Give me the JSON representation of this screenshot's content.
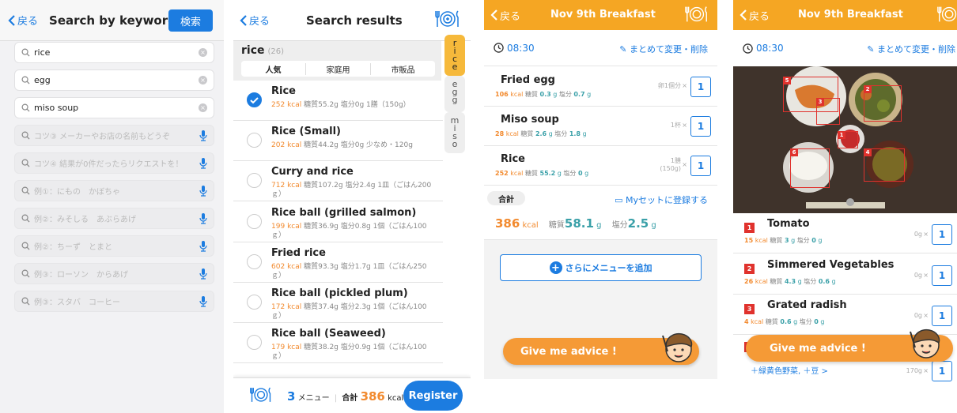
{
  "colors": {
    "accent_blue": "#1c7ce0",
    "orange": "#f5a623",
    "kcal_orange": "#f28a2e",
    "teal": "#3aa0a8",
    "tag_red": "#e0322d"
  },
  "search_screen": {
    "back_label": "戻る",
    "title": "Search by keyword",
    "search_button": "検索",
    "history": [
      {
        "text": "rice"
      },
      {
        "text": "egg"
      },
      {
        "text": "miso soup"
      }
    ],
    "placeholders": [
      {
        "text": "コツ③ メーカーやお店の名前もどうぞ"
      },
      {
        "text": "コツ④ 結果が0件だったらリクエストを！"
      },
      {
        "text": "例①：にもの　かぼちゃ"
      },
      {
        "text": "例②：みそしる　あぶらあげ"
      },
      {
        "text": "例②：ちーず　とまと"
      },
      {
        "text": "例③：ローソン　からあげ"
      },
      {
        "text": "例③：スタバ　コーヒー"
      }
    ]
  },
  "results_screen": {
    "back_label": "戻る",
    "title": "Search results",
    "keyword": "rice",
    "count": "(26)",
    "tabs": [
      "人気",
      "家庭用",
      "市販品"
    ],
    "side_tabs": [
      "r\ni\nc\ne",
      "e\ng\ng",
      "m\ni\ns\no"
    ],
    "items": [
      {
        "name": "Rice",
        "kcal": "252",
        "unit": "kcal",
        "detail": "糖質55.2g  塩分0g  1膳（150g）",
        "checked": true
      },
      {
        "name": "Rice (Small)",
        "kcal": "202",
        "unit": "kcal",
        "detail": "糖質44.2g  塩分0g  少なめ・120g",
        "checked": false
      },
      {
        "name": "Curry and rice",
        "kcal": "712",
        "unit": "kcal",
        "detail": "糖質107.2g  塩分2.4g  1皿（ごはん200ｇ）",
        "checked": false
      },
      {
        "name": "Rice ball (grilled salmon)",
        "kcal": "199",
        "unit": "kcal",
        "detail": "糖質36.9g  塩分0.8g  1個（ごはん100ｇ）",
        "checked": false
      },
      {
        "name": "Fried rice",
        "kcal": "602",
        "unit": "kcal",
        "detail": "糖質93.3g  塩分1.7g  1皿（ごはん250ｇ）",
        "checked": false
      },
      {
        "name": "Rice ball (pickled plum)",
        "kcal": "172",
        "unit": "kcal",
        "detail": "糖質37.4g  塩分2.3g  1個（ごはん100ｇ）",
        "checked": false
      },
      {
        "name": "Rice ball (Seaweed)",
        "kcal": "179",
        "unit": "kcal",
        "detail": "糖質38.2g  塩分0.9g  1個（ごはん100ｇ）",
        "checked": false
      }
    ],
    "footer": {
      "menu_count": "3",
      "menu_label": "メニュー",
      "total_label": "合計",
      "total_kcal": "386",
      "kcal_unit": "kcal",
      "register": "Register"
    }
  },
  "meal_screen": {
    "back_label": "戻る",
    "title": "Nov 9th  Breakfast",
    "time": "08:30",
    "edit_label": "まとめて変更・削除",
    "items": [
      {
        "name": "Fried egg",
        "kcal": "106",
        "kcal_unit": "kcal",
        "carb_label": "糖質",
        "carb": "0.3",
        "carb_unit": "g",
        "salt_label": "塩分",
        "salt": "0.7",
        "salt_unit": "g",
        "portion": "卵1個分",
        "qty": "1"
      },
      {
        "name": "Miso soup",
        "kcal": "28",
        "kcal_unit": "kcal",
        "carb_label": "糖質",
        "carb": "2.6",
        "carb_unit": "g",
        "salt_label": "塩分",
        "salt": "1.8",
        "salt_unit": "g",
        "portion": "1杯",
        "qty": "1"
      },
      {
        "name": "Rice",
        "kcal": "252",
        "kcal_unit": "kcal",
        "carb_label": "糖質",
        "carb": "55.2",
        "carb_unit": "g",
        "salt_label": "塩分",
        "salt": "0",
        "salt_unit": "g",
        "portion": "1膳\n(150g)",
        "qty": "1"
      }
    ],
    "total_label": "合計",
    "myset_label": "Myセットに登録する",
    "total_kcal": "386",
    "kcal_unit": "kcal",
    "carb_label": "糖質",
    "total_carb": "58.1",
    "carb_unit": "g",
    "salt_label": "塩分",
    "total_salt": "2.5",
    "salt_unit": "g",
    "add_menu": "さらにメニューを追加",
    "advice": "Give me advice !"
  },
  "photo_screen": {
    "back_label": "戻る",
    "title": "Nov 9th  Breakfast",
    "time": "08:30",
    "edit_label": "まとめて変更・削除",
    "detections": [
      "5",
      "3",
      "2",
      "1",
      "6",
      "4"
    ],
    "items": [
      {
        "tag": "1",
        "name": "Tomato",
        "kcal": "15",
        "kcal_unit": "kcal",
        "carb_label": "糖質",
        "carb": "3",
        "carb_unit": "g",
        "salt_label": "塩分",
        "salt": "0",
        "salt_unit": "g",
        "grams": "0g",
        "qty": "1"
      },
      {
        "tag": "2",
        "name": "Simmered Vegetables",
        "kcal": "26",
        "kcal_unit": "kcal",
        "carb_label": "糖質",
        "carb": "4.3",
        "carb_unit": "g",
        "salt_label": "塩分",
        "salt": "0.6",
        "salt_unit": "g",
        "grams": "0g",
        "qty": "1"
      },
      {
        "tag": "3",
        "name": "Grated radish",
        "kcal": "4",
        "kcal_unit": "kcal",
        "carb_label": "糖質",
        "carb": "0.6",
        "carb_unit": "g",
        "salt_label": "塩分",
        "salt": "0",
        "salt_unit": "g",
        "grams": "0g",
        "qty": "1"
      },
      {
        "tag": "4",
        "sub": "＋緑黄色野菜, ＋豆 >",
        "grams": "170g",
        "qty": "1"
      }
    ],
    "advice": "Give me advice !"
  }
}
